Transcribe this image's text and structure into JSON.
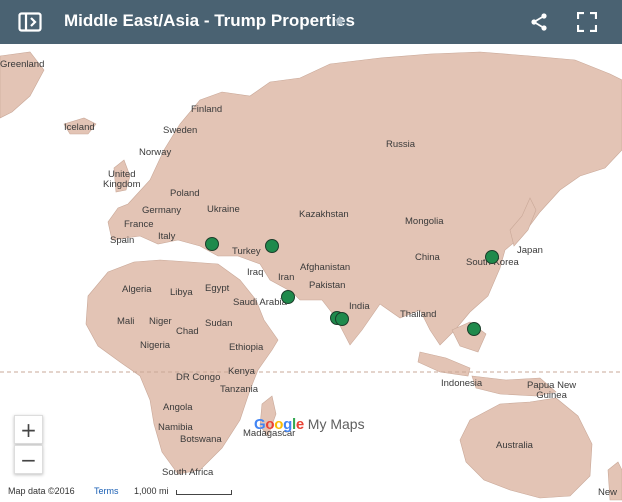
{
  "header": {
    "title": "Middle East/Asia - Trump Properties",
    "star_glyph": "★",
    "left_icon": "sidebar-toggle-icon",
    "share_icon": "share-icon",
    "fullscreen_icon": "fullscreen-icon"
  },
  "colors": {
    "header_bg": "#4a6272",
    "land": "#e3c4b5",
    "marker": "#1f8a4c"
  },
  "map": {
    "labels": {
      "greenland": "Greenland",
      "iceland": "Iceland",
      "finland": "Finland",
      "sweden": "Sweden",
      "norway": "Norway",
      "united_kingdom": "United\nKingdom",
      "poland": "Poland",
      "germany": "Germany",
      "ukraine": "Ukraine",
      "france": "France",
      "spain": "Spain",
      "italy": "Italy",
      "turkey": "Turkey",
      "russia": "Russia",
      "kazakhstan": "Kazakhstan",
      "mongolia": "Mongolia",
      "iraq": "Iraq",
      "iran": "Iran",
      "afghanistan": "Afghanistan",
      "pakistan": "Pakistan",
      "china": "China",
      "south_korea": "South Korea",
      "japan": "Japan",
      "algeria": "Algeria",
      "libya": "Libya",
      "egypt": "Egypt",
      "saudi_arabia": "Saudi Arabia",
      "india": "India",
      "thailand": "Thailand",
      "mali": "Mali",
      "niger": "Niger",
      "chad": "Chad",
      "sudan": "Sudan",
      "nigeria": "Nigeria",
      "ethiopia": "Ethiopia",
      "dr_congo": "DR Congo",
      "kenya": "Kenya",
      "tanzania": "Tanzania",
      "indonesia": "Indonesia",
      "papua_new_guinea": "Papua New\nGuinea",
      "angola": "Angola",
      "namibia": "Namibia",
      "botswana": "Botswana",
      "madagascar": "Madagascar",
      "south_africa": "South Africa",
      "australia": "Australia",
      "new": "New"
    },
    "markers": [
      {
        "name": "Istanbul, Turkey"
      },
      {
        "name": "Baku, Azerbaijan"
      },
      {
        "name": "Dubai, UAE"
      },
      {
        "name": "Mumbai, India"
      },
      {
        "name": "Pune, India"
      },
      {
        "name": "Manila, Philippines"
      },
      {
        "name": "Seoul, South Korea"
      }
    ]
  },
  "controls": {
    "zoom_in": "+",
    "zoom_out": "−"
  },
  "footer": {
    "map_data": "Map data ©2016",
    "terms": "Terms",
    "scale": "1,000 mi",
    "logo_brand": "Google",
    "logo_product": "My Maps"
  }
}
